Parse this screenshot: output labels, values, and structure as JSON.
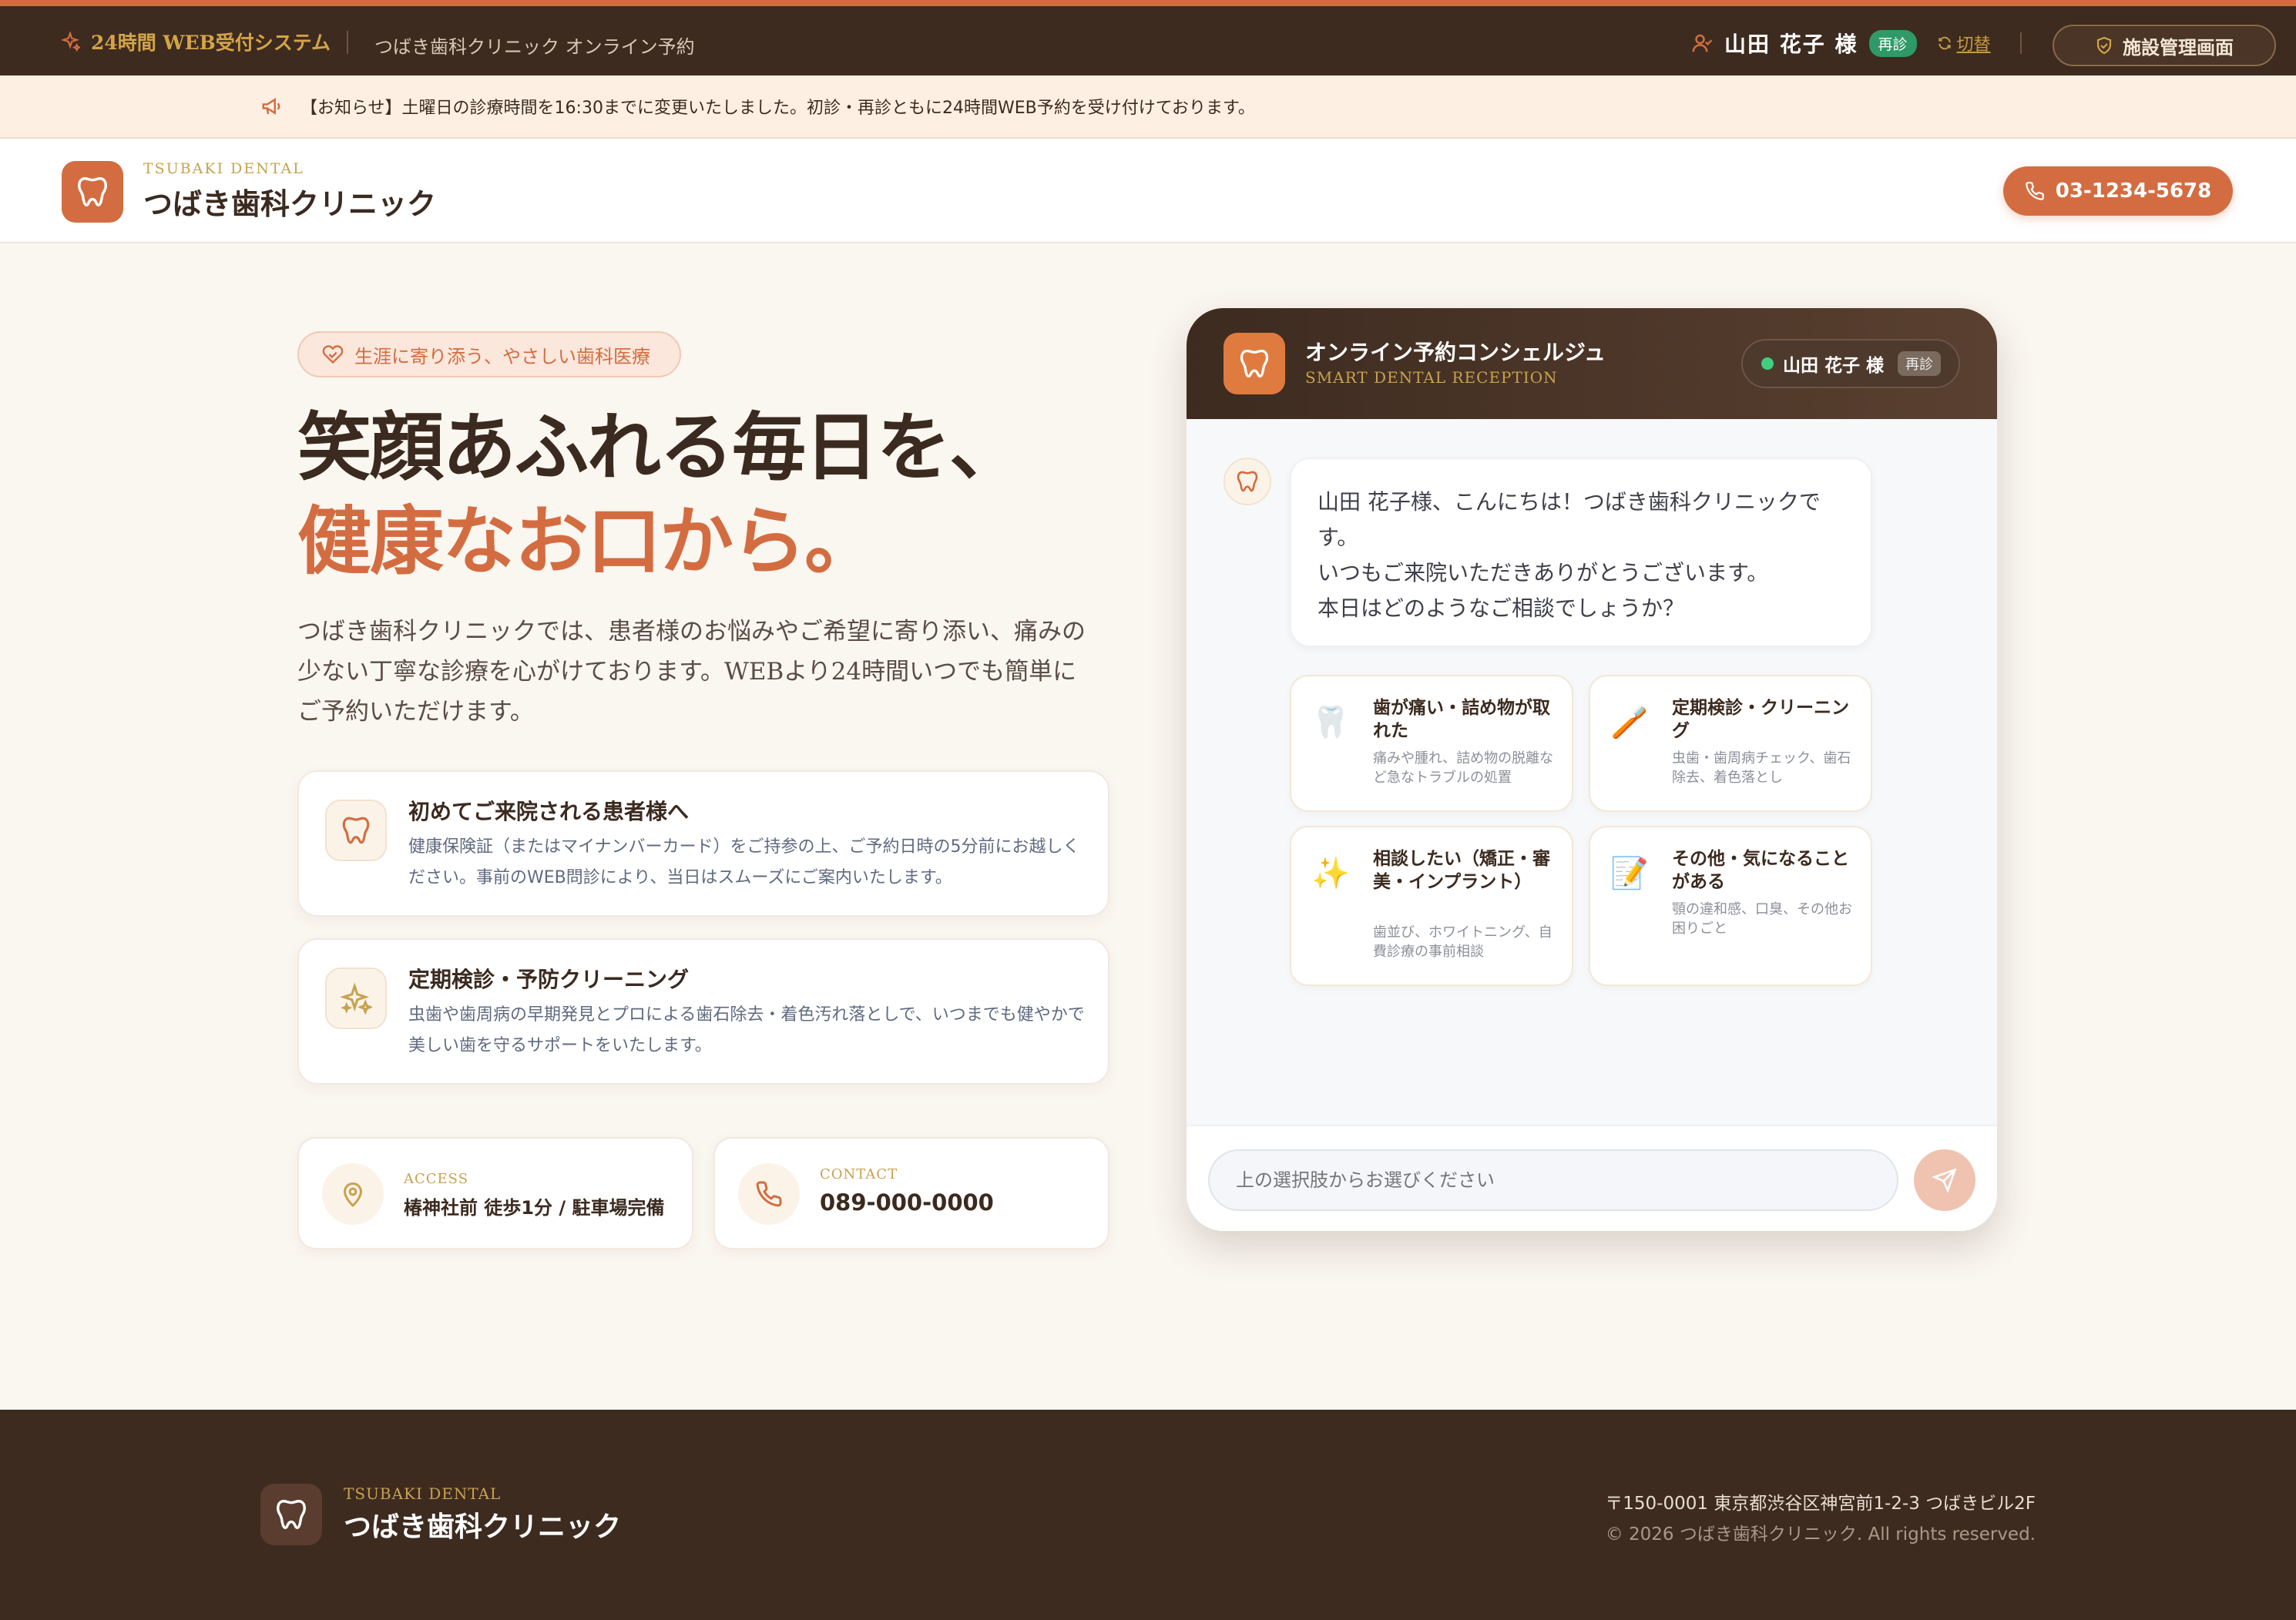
{
  "topbar": {
    "system_label": "24時間 WEB受付システム",
    "clinic_sub": "つばき歯科クリニック オンライン予約",
    "user_name": "山田 花子 様",
    "user_badge": "再診",
    "switch_label": "切替",
    "admin_label": "施設管理画面"
  },
  "notice": {
    "text": "【お知らせ】土曜日の診療時間を16:30までに変更いたしました。初診・再診ともに24時間WEB予約を受け付けております。"
  },
  "header": {
    "logo_en": "TSUBAKI DENTAL",
    "logo_jp": "つばき歯科クリニック",
    "phone": "03-1234-5678"
  },
  "hero": {
    "tag": "生涯に寄り添う、やさしい歯科医療",
    "title_line1": "笑顔あふれる毎日を、",
    "title_line2": "健康なお口から。",
    "lead": "つばき歯科クリニックでは、患者様のお悩みやご希望に寄り添い、痛みの少ない丁寧な診療を心がけております。WEBより24時間いつでも簡単にご予約いただけます。"
  },
  "cards": [
    {
      "title": "初めてご来院される患者様へ",
      "desc": "健康保険証（またはマイナンバーカード）をご持参の上、ご予約日時の5分前にお越しください。事前のWEB問診により、当日はスムーズにご案内いたします。"
    },
    {
      "title": "定期検診・予防クリーニング",
      "desc": "虫歯や歯周病の早期発見とプロによる歯石除去・着色汚れ落としで、いつまでも健やかで美しい歯を守るサポートをいたします。"
    }
  ],
  "info": {
    "access_label": "ACCESS",
    "access_value": "椿神社前 徒歩1分 / 駐車場完備",
    "contact_label": "CONTACT",
    "contact_value": "089-000-0000"
  },
  "chat": {
    "title": "オンライン予約コンシェルジュ",
    "subtitle": "SMART DENTAL RECEPTION",
    "user_name": "山田 花子 様",
    "user_badge": "再診",
    "message_lines": [
      "山田 花子様、こんにちは！つばき歯科クリニックで",
      "す。",
      "いつもご来院いただきありがとうございます。",
      "本日はどのようなご相談でしょうか？"
    ],
    "options": [
      {
        "emoji": "🦷",
        "title": "歯が痛い・詰め物が取れた",
        "desc": "痛みや腫れ、詰め物の脱離など急なトラブルの処置"
      },
      {
        "emoji": "🪥",
        "title": "定期検診・クリーニング",
        "desc": "虫歯・歯周病チェック、歯石除去、着色落とし"
      },
      {
        "emoji": "✨",
        "title": "相談したい（矯正・審美・インプラント）",
        "desc": "歯並び、ホワイトニング、自費診療の事前相談"
      },
      {
        "emoji": "📝",
        "title": "その他・気になることがある",
        "desc": "顎の違和感、口臭、その他お困りごと"
      }
    ],
    "input_placeholder": "上の選択肢からお選びください"
  },
  "footer": {
    "logo_en": "TSUBAKI DENTAL",
    "logo_jp": "つばき歯科クリニック",
    "address": "〒150-0001 東京都渋谷区神宮前1-2-3 つばきビル2F",
    "copyright": "© 2026 つばき歯科クリニック. All rights reserved."
  },
  "colors": {
    "accent": "#d36d41",
    "dark": "#3d2b20",
    "gold": "#c8a24f",
    "online": "#3fcf7f"
  },
  "icons": [
    "sparkle-icon",
    "user-icon",
    "refresh-icon",
    "shield-icon",
    "megaphone-icon",
    "tooth-icon",
    "phone-icon",
    "heart-icon",
    "map-pin-icon",
    "send-icon"
  ]
}
